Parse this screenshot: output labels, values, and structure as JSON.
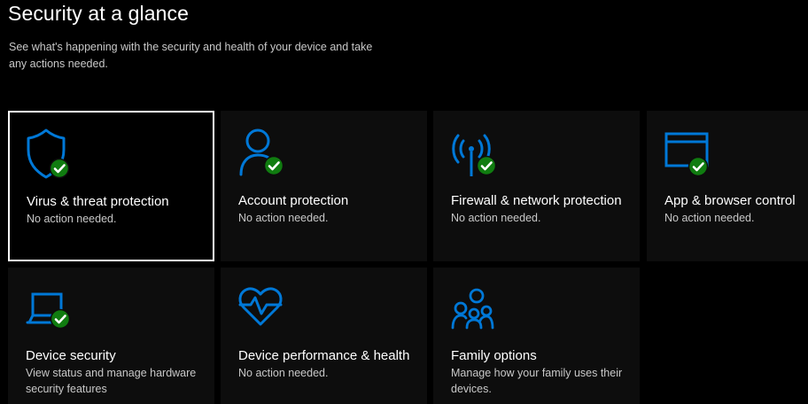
{
  "page": {
    "title": "Security at a glance",
    "subtitle": "See what's happening with the security and health of your device and take any actions needed."
  },
  "colors": {
    "background": "#000000",
    "tile_background": "#0d0d0d",
    "icon_blue": "#0078d7",
    "ok_green": "#107c10",
    "text_primary": "#ffffff",
    "text_secondary": "#c8c8c8",
    "focus_border": "#ffffff"
  },
  "tiles": [
    {
      "name": "Virus & threat protection",
      "status": "No action needed.",
      "icon": "shield-icon",
      "status_icon": "check-circle-icon",
      "selected": true
    },
    {
      "name": "Account protection",
      "status": "No action needed.",
      "icon": "person-icon",
      "status_icon": "check-circle-icon"
    },
    {
      "name": "Firewall & network protection",
      "status": "No action needed.",
      "icon": "wifi-antenna-icon",
      "status_icon": "check-circle-icon"
    },
    {
      "name": "App & browser control",
      "status": "No action needed.",
      "icon": "browser-window-icon",
      "status_icon": "check-circle-icon"
    },
    {
      "name": "Device security",
      "status": "View status and manage hardware security features",
      "icon": "laptop-icon",
      "status_icon": "check-circle-icon"
    },
    {
      "name": "Device performance & health",
      "status": "No action needed.",
      "icon": "heart-pulse-icon"
    },
    {
      "name": "Family options",
      "status": "Manage how your family uses their devices.",
      "icon": "family-icon"
    }
  ]
}
